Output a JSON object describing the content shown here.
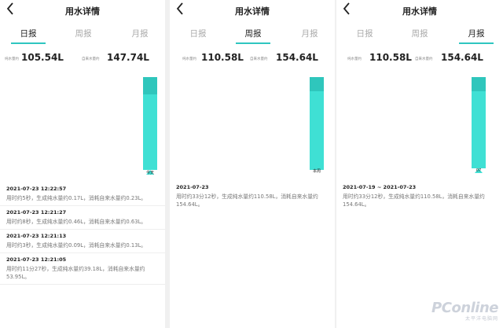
{
  "panels": [
    {
      "title": "用水详情",
      "tabs": [
        "日报",
        "周报",
        "月报"
      ],
      "active_tab": 0,
      "pure_label": "纯水量约",
      "pure_value": "105.54L",
      "tap_label": "自来水量约",
      "tap_value": "147.74L",
      "bar_tag": "今天",
      "records": [
        {
          "time": "2021-07-23 12:22:57",
          "desc": "用时约5秒，生成纯水量约0.17L，消耗自来水量约0.23L。"
        },
        {
          "time": "2021-07-23 12:21:27",
          "desc": "用时约8秒，生成纯水量约0.46L，消耗自来水量约0.63L。"
        },
        {
          "time": "2021-07-23 12:21:13",
          "desc": "用时约3秒，生成纯水量约0.09L，消耗自来水量约0.13L。"
        },
        {
          "time": "2021-07-23 12:21:05",
          "desc": "用时约11分27秒，生成纯水量约39.18L，消耗自来水量约53.95L。"
        }
      ]
    },
    {
      "title": "用水详情",
      "tabs": [
        "日报",
        "周报",
        "月报"
      ],
      "active_tab": 1,
      "pure_label": "纯水量约",
      "pure_value": "110.58L",
      "tap_label": "自来水量约",
      "tap_value": "154.64L",
      "bar_tag": "本周",
      "records": [
        {
          "time": "2021-07-23",
          "desc": "用时约33分12秒，生成纯水量约110.58L，消耗自来水量约154.64L。"
        }
      ]
    },
    {
      "title": "用水详情",
      "tabs": [
        "日报",
        "周报",
        "月报"
      ],
      "active_tab": 2,
      "pure_label": "纯水量约",
      "pure_value": "110.58L",
      "tap_label": "自来水量约",
      "tap_value": "154.64L",
      "bar_tag": "07",
      "records": [
        {
          "time": "2021-07-19 ~ 2021-07-23",
          "desc": "用时约33分12秒，生成纯水量约110.58L，消耗自来水量约154.64L。"
        }
      ]
    }
  ],
  "watermark": {
    "main": "PConline",
    "sub": "太平洋电脑网"
  },
  "colors": {
    "accent": "#2fc6c0",
    "bar": "#3fe0d4",
    "bar_top": "#2fc6bc"
  }
}
